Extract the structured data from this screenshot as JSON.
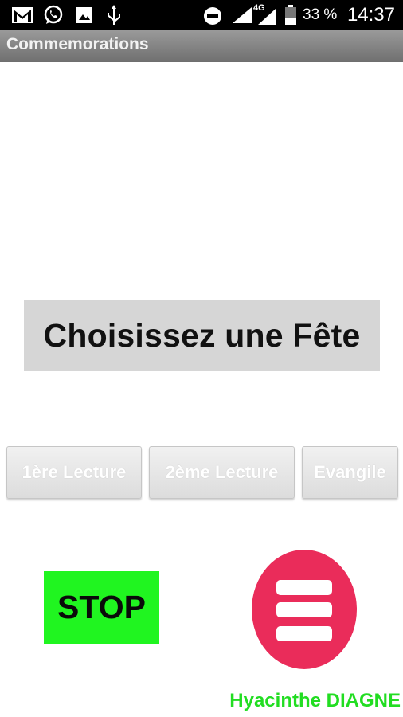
{
  "status_bar": {
    "battery_text": "33 %",
    "network_text": "4G",
    "time": "14:37"
  },
  "title_bar": {
    "title": "Commemorations"
  },
  "main": {
    "heading": "Choisissez une Fête",
    "buttons": [
      {
        "label": "1ère Lecture"
      },
      {
        "label": "2ème Lecture"
      },
      {
        "label": "Evangile"
      }
    ],
    "stop_label": "STOP",
    "author": "Hyacinthe DIAGNE"
  },
  "colors": {
    "stop_green": "#20f520",
    "menu_pink": "#ea2c5a",
    "author_green": "#22dd22"
  },
  "icons": [
    "gmail-icon",
    "whatsapp-icon",
    "gallery-icon",
    "usb-icon",
    "do-not-disturb-icon",
    "wifi-icon",
    "signal-icon",
    "battery-icon",
    "hamburger-menu-icon"
  ]
}
